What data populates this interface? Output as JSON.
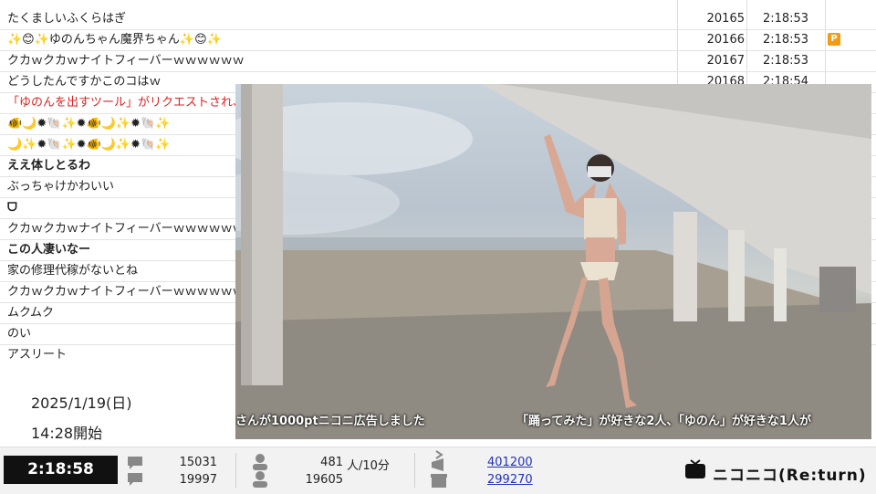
{
  "comments": [
    {
      "text": "たくましいふくらはぎ",
      "no": "20165",
      "time": "2:18:53",
      "style": ""
    },
    {
      "text": "✨😊✨ゆのんちゃん魔界ちゃん✨😊✨",
      "no": "20166",
      "time": "2:18:53",
      "style": "",
      "premium": "P"
    },
    {
      "text": "クカｗクカｗナイトフィーバーｗｗｗｗｗｗ",
      "no": "20167",
      "time": "2:18:53",
      "style": ""
    },
    {
      "text": "どうしたんですかこのコはｗ",
      "no": "20168",
      "time": "2:18:54",
      "style": ""
    },
    {
      "text": "「ゆのんを出すツール」がリクエストされ、「今",
      "no": "",
      "time": "",
      "style": "red"
    },
    {
      "text": "🐠🌙✹🐚✨✹🐠🌙✨✹🐚✨",
      "no": "",
      "time": "",
      "style": "sparkle"
    },
    {
      "text": "🌙✨✹🐚✨✹🐠🌙✨✹🐚✨",
      "no": "",
      "time": "",
      "style": "sparkle"
    },
    {
      "text": "ええ体しとるわ",
      "no": "",
      "time": "",
      "style": "bold"
    },
    {
      "text": "ぶっちゃけかわいい",
      "no": "",
      "time": "",
      "style": ""
    },
    {
      "text": "ᗜ",
      "no": "",
      "time": "",
      "style": "bold"
    },
    {
      "text": "クカｗクカｗナイトフィーバーｗｗｗｗｗｗ",
      "no": "",
      "time": "",
      "style": ""
    },
    {
      "text": "この人凄いなー",
      "no": "",
      "time": "",
      "style": "bold"
    },
    {
      "text": "家の修理代稼がないとね",
      "no": "",
      "time": "",
      "style": ""
    },
    {
      "text": "クカｗクカｗナイトフィーバーｗｗｗｗｗｗ",
      "no": "",
      "time": "",
      "style": ""
    },
    {
      "text": "ムクムク",
      "no": "",
      "time": "",
      "style": ""
    },
    {
      "text": "のい",
      "no": "",
      "time": "",
      "style": ""
    },
    {
      "text": "アスリート",
      "no": "",
      "time": "",
      "style": ""
    }
  ],
  "info": {
    "date": "2025/1/19(日)",
    "start": "14:28開始"
  },
  "video": {
    "telop_left": "さんが1000ptニコニ広告しました",
    "telop_right": "「踊ってみた」が好きな2人、「ゆのん」が好きな1人が"
  },
  "bar": {
    "elapsed": "2:18:58",
    "comments_count": "15031",
    "comments_total": "19997",
    "viewers_10min": "481",
    "viewers_unit": "人/10分",
    "viewers_total": "19605",
    "ad_points": "401200",
    "gift_points": "299270",
    "logo": "ニコニコ(Re:turn)"
  },
  "colors": {
    "accent_red": "#e02020",
    "link_blue": "#2233bb",
    "premium_orange": "#f39c12"
  }
}
